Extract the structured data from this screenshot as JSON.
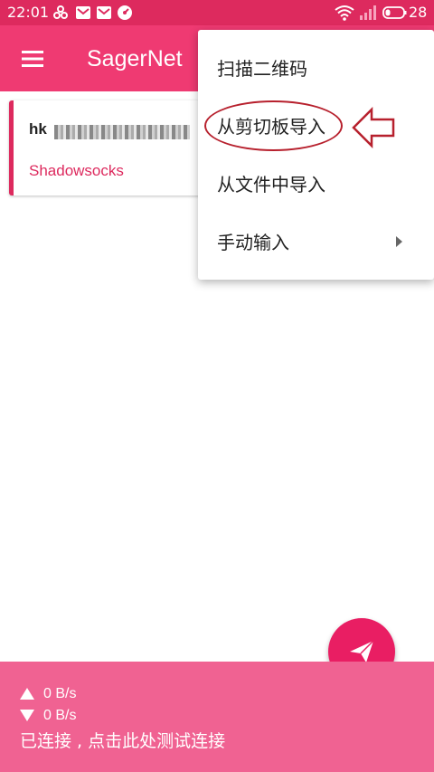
{
  "status_bar": {
    "time": "22:01",
    "battery_level": "28",
    "left_icons": [
      "cluster-icon",
      "mail-icon",
      "mail-icon",
      "gauge-icon"
    ],
    "right_icons": [
      "wifi-icon",
      "signal-icon",
      "battery-icon"
    ]
  },
  "toolbar": {
    "title": "SagerNet",
    "menu_icon": "hamburger-icon"
  },
  "profile": {
    "name_prefix": "hk",
    "type": "Shadowsocks"
  },
  "popup_menu": {
    "items": [
      {
        "label": "扫描二维码"
      },
      {
        "label": "从剪切板导入"
      },
      {
        "label": "从文件中导入"
      },
      {
        "label": "手动输入",
        "has_submenu": true
      }
    ]
  },
  "fab": {
    "icon": "send-icon"
  },
  "stats": {
    "upload": "0 B/s",
    "download": "0 B/s",
    "status": "已连接 , 点击此处测试连接"
  },
  "colors": {
    "primary": "#ef3a72",
    "status_bar": "#dd2a5e",
    "accent": "#e91e63",
    "stats_bar": "#f06292",
    "annotation": "#b7202d"
  }
}
